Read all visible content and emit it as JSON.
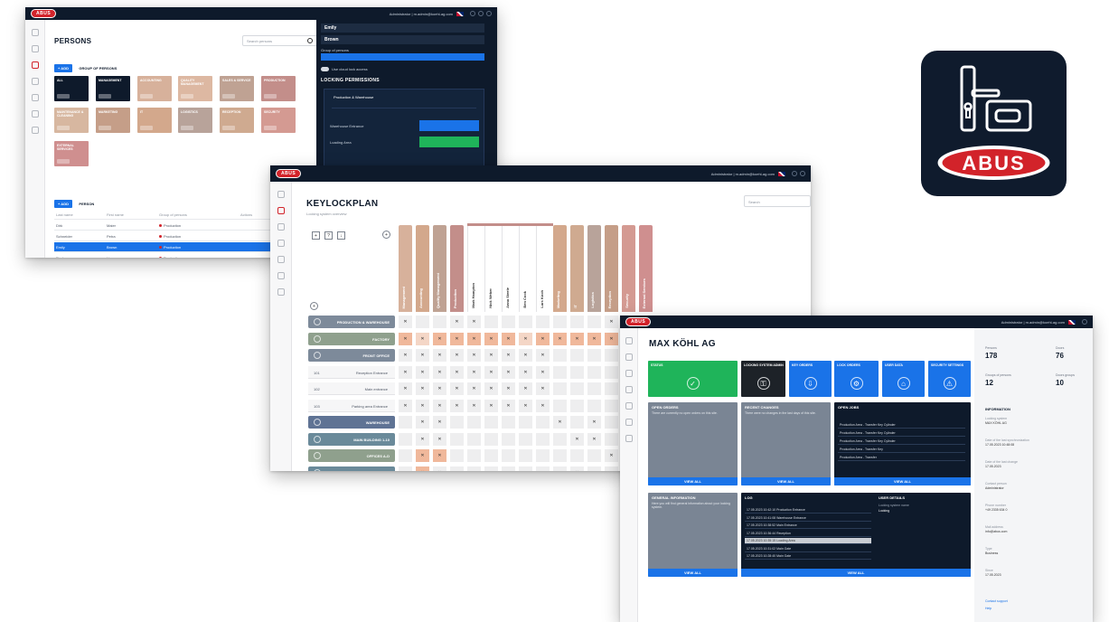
{
  "brand": {
    "logo": "ABUS",
    "accent": "#d2232a",
    "navy": "#0e1a2b",
    "blue": "#1a73e8",
    "green": "#1fb45a"
  },
  "app_icon": {
    "name": "ABUS"
  },
  "persons_window": {
    "title": "PERSONS",
    "search_placeholder": "Search persons",
    "add_group_label": "+ ADD",
    "group_heading": "GROUP OF PERSONS",
    "add_person_label": "+ ADD",
    "person_heading": "PERSON",
    "tiles": [
      {
        "label": "ALL",
        "color": "#0e1a2b"
      },
      {
        "label": "MANAGEMENT",
        "color": "#0e1a2b"
      },
      {
        "label": "ACCOUNTING",
        "color": "#d7b19b"
      },
      {
        "label": "QUALITY MANAGEMENT",
        "color": "#ddb8a2"
      },
      {
        "label": "SALES & SERVICE",
        "color": "#bfa293"
      },
      {
        "label": "PRODUCTION",
        "color": "#c38e8a"
      },
      {
        "label": "MAINTENANCE & CLEANING",
        "color": "#d7b7a0"
      },
      {
        "label": "MARKETING",
        "color": "#c59e88"
      },
      {
        "label": "IT",
        "color": "#d3a88c"
      },
      {
        "label": "LOGISTICS",
        "color": "#b8a39a"
      },
      {
        "label": "RECEPTION",
        "color": "#cfaa90"
      },
      {
        "label": "SECURITY",
        "color": "#d49a92"
      },
      {
        "label": "EXTERNAL SERVICES",
        "color": "#cf8f8f"
      }
    ],
    "table_headers": [
      "Last name",
      "First name",
      "Group of persons",
      "Actions"
    ],
    "rows": [
      {
        "last": "Dirk",
        "first": "Maier",
        "group": "Production",
        "selected": false
      },
      {
        "last": "Schneider",
        "first": "Petra",
        "group": "Production",
        "selected": false
      },
      {
        "last": "Emily",
        "first": "Brown",
        "group": "Production",
        "selected": true
      },
      {
        "last": "Fischer",
        "first": "Lisa",
        "group": "Production",
        "selected": false
      }
    ],
    "panel": {
      "first_name": "Emily",
      "last_name": "Brown",
      "group_label": "Group of persons",
      "toggle_label": "Use cloud lock access",
      "section": "LOCKING PERMISSIONS",
      "permission_item": "Production & Warehouse",
      "row1_label": "Warehouse Entrance",
      "row2_label": "Loading Area"
    }
  },
  "keylock_window": {
    "title": "KEYLOCKPLAN",
    "subtitle": "Locking system overview",
    "search_placeholder": "Search",
    "toolbar": [
      "+",
      "?",
      "↓"
    ],
    "columns": [
      {
        "label": "Management",
        "color": "#d7b19b"
      },
      {
        "label": "Accounting",
        "color": "#d3a88c"
      },
      {
        "label": "Quality Management",
        "color": "#bfa293"
      },
      {
        "label": "Production",
        "color": "#c38e8a"
      },
      {
        "label": "Mark Hampton",
        "color": "#ffffff"
      },
      {
        "label": "Nick Weber",
        "color": "#ffffff"
      },
      {
        "label": "Anna Steele",
        "color": "#ffffff"
      },
      {
        "label": "Ben Cook",
        "color": "#ffffff"
      },
      {
        "label": "Lars Koch",
        "color": "#ffffff"
      },
      {
        "label": "Marketing",
        "color": "#d3a88c"
      },
      {
        "label": "IT",
        "color": "#cfaa90"
      },
      {
        "label": "Logistics",
        "color": "#b8a39a"
      },
      {
        "label": "Reception",
        "color": "#c59e88"
      },
      {
        "label": "Security",
        "color": "#d49a92"
      },
      {
        "label": "External Services",
        "color": "#cf8f8f"
      }
    ],
    "row_groups": [
      {
        "label": "PRODUCTION & WAREHOUSE",
        "color": "#7d8a9a"
      },
      {
        "label": "FACTORY",
        "color": "#8fa08d"
      },
      {
        "label": "FRONT OFFICE",
        "color": "#7d8a9a"
      }
    ],
    "sub_rows": [
      {
        "num": "101",
        "name": "Reception Entrance"
      },
      {
        "num": "102",
        "name": "Main entrance"
      },
      {
        "num": "103",
        "name": "Parking area Entrance"
      }
    ],
    "row_groups_2": [
      {
        "label": "WAREHOUSE",
        "color": "#5f7394"
      },
      {
        "label": "MAIN BUILDING 1-10",
        "color": "#6a8a9a"
      },
      {
        "label": "OFFICES A-D",
        "color": "#8fa08d"
      },
      {
        "label": "ARCHIVE & SERVER",
        "color": "#6a8a9a"
      }
    ]
  },
  "company_window": {
    "title": "MAX KÖHL AG",
    "tiles": [
      {
        "label": "STATUS",
        "color": "#1fb45a"
      },
      {
        "label": "LOCKING SYSTEM ADMIN",
        "color": "#1d2228"
      },
      {
        "label": "KEY ORDERS",
        "color": "#1a73e8"
      },
      {
        "label": "LOCK ORDERS",
        "color": "#1a73e8"
      },
      {
        "label": "USER DATA",
        "color": "#1a73e8"
      },
      {
        "label": "SECURITY SETTINGS",
        "color": "#1a73e8"
      }
    ],
    "cards": {
      "open_orders": {
        "title": "OPEN ORDERS",
        "text": "There are currently no open orders on this site.",
        "footer": "VIEW ALL"
      },
      "recent_changes": {
        "title": "RECENT CHANGES",
        "text": "There were no changes in the last days of this site.",
        "footer": "VIEW ALL"
      },
      "open_jobs": {
        "title": "OPEN JOBS",
        "footer": "VIEW ALL",
        "rows": [
          "Production Area - Transfer Key Cylinder",
          "Production Area - Transfer Key Cylinder",
          "Production Area - Transfer Key Cylinder",
          "Production Area - Transfer Key",
          "Production Area - Transfer"
        ]
      },
      "general_information": {
        "title": "GENERAL INFORMATION",
        "text": "Here you will find general information about your locking system.",
        "footer": "VIEW ALL"
      },
      "log": {
        "title": "LOG",
        "footer": "VIEW ALL",
        "rows": [
          "17.05.2023 10:42:10  Production Entrance",
          "17.05.2023 10:41:08  Warehouse Entrance",
          "17.05.2023 10:38:52  Main Entrance",
          "17.05.2023 10:36:44  Reception",
          "17.05.2023 10:35:15  Loading Area",
          "17.05.2023 10:31:02  Main Gate",
          "17.05.2023 10:28:40  Main Gate"
        ]
      },
      "user_details": {
        "title": "USER DETAILS",
        "lines": [
          "Locking system name",
          "Locking"
        ]
      }
    },
    "stats": [
      {
        "label": "Persons",
        "value": "178"
      },
      {
        "label": "Doors",
        "value": "76"
      },
      {
        "label": "Groups of persons",
        "value": "12"
      },
      {
        "label": "Doors groups",
        "value": "10"
      }
    ],
    "info_heading": "INFORMATION",
    "info": [
      {
        "label": "Locking system",
        "value": "MAX KÖHL AG"
      },
      {
        "label": "Date of the last synchronization",
        "value": "17.05.2023 10:48:08"
      },
      {
        "label": "Date of the last change",
        "value": "17.05.2023"
      },
      {
        "label": "Contact person",
        "value": "Administrator"
      },
      {
        "label": "Phone number",
        "value": "+49 2335 634 0"
      },
      {
        "label": "Mail address",
        "value": "info@abus.com"
      },
      {
        "label": "Type",
        "value": "Business"
      },
      {
        "label": "Since",
        "value": "17.05.2023"
      }
    ],
    "links": [
      "Contact support",
      "Help"
    ]
  }
}
